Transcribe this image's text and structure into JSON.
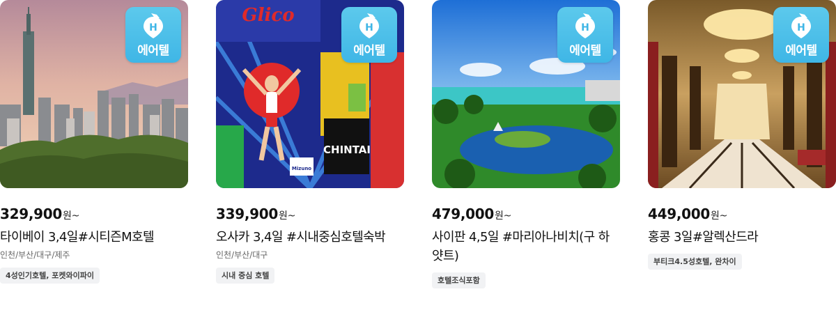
{
  "brand_badge": "에어텔",
  "products": [
    {
      "price": "329,900",
      "unit": "원~",
      "title": "타이베이 3,4일#시티즌M호텔",
      "departures": "인천/부산/대구/제주",
      "tag": "4성인기호텔, 포켓와이파이"
    },
    {
      "price": "339,900",
      "unit": "원~",
      "title": "오사카 3,4일 #시내중심호텔숙박",
      "departures": "인천/부산/대구",
      "tag": "시내 중심 호텔"
    },
    {
      "price": "479,000",
      "unit": "원~",
      "title": "사이판 4,5일 #마리아나비치(구 하얏트)",
      "departures": "",
      "tag": "호텔조식포함"
    },
    {
      "price": "449,000",
      "unit": "원~",
      "title": "홍콩 3일#알렉산드라",
      "departures": "",
      "tag": "부티크4.5성호텔, 완차이"
    }
  ],
  "image_text": {
    "glico": "Glico",
    "chintai": "CHINTAI",
    "mizuno": "Mizuno"
  }
}
